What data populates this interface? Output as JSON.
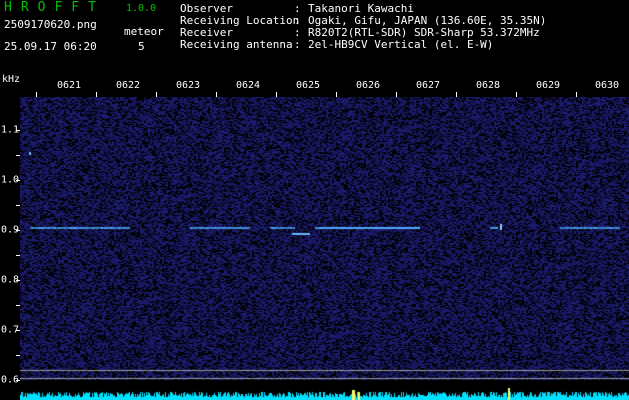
{
  "app": {
    "title": "HROFFT",
    "version": "1.0.0"
  },
  "file": {
    "name": "2509170620.png",
    "timestamp": "25.09.17 06:20"
  },
  "meteor": {
    "label": "meteor",
    "count": "5"
  },
  "info": [
    {
      "label": "Observer",
      "value": "Takanori Kawachi"
    },
    {
      "label": "Receiving Location",
      "value": "Ogaki, Gifu, JAPAN (136.60E, 35.35N)"
    },
    {
      "label": "Receiver",
      "value": "R820T2(RTL-SDR) SDR-Sharp 53.372MHz"
    },
    {
      "label": "Receiving antenna",
      "value": "2el-HB9CV Vertical (el. E-W)"
    }
  ],
  "separator": ":",
  "axis": {
    "unit": "kHz",
    "time_ticks": [
      "0621",
      "0622",
      "0623",
      "0624",
      "0625",
      "0626",
      "0627",
      "0628",
      "0629",
      "0630"
    ],
    "freq_ticks": [
      "1.1",
      "1.0",
      "0.9",
      "0.8",
      "0.7",
      "0.6"
    ]
  },
  "colors": {
    "title": "#00c000",
    "text": "#ffffff",
    "background": "#000000",
    "noise": "#1a1a6e",
    "signal": "#4fa8ff",
    "strong_signal": "#ffff60",
    "baseline": "#00e0ff"
  },
  "signal": {
    "carrier_khz": 0.905
  }
}
